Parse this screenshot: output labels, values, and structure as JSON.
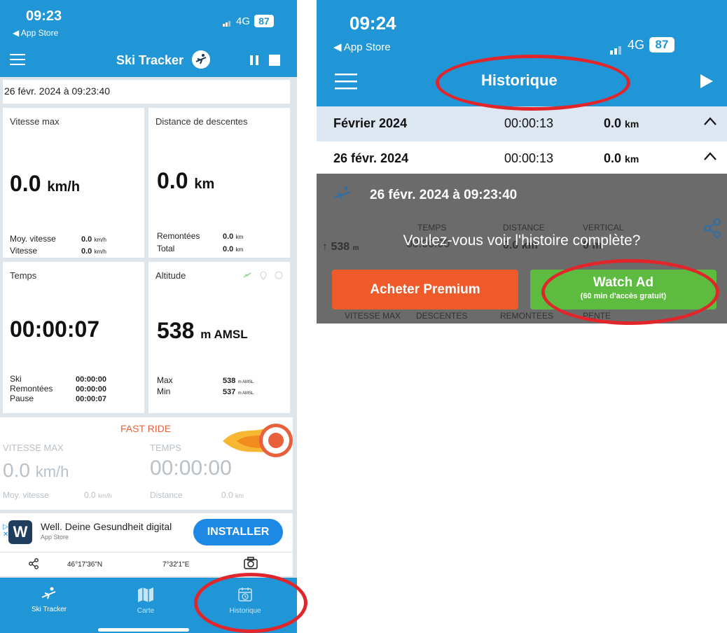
{
  "left": {
    "status": {
      "time": "09:23",
      "back": "◀ App Store",
      "network": "4G",
      "battery": "87"
    },
    "header": {
      "title": "Ski Tracker"
    },
    "date": "26 févr. 2024 à 09:23:40",
    "speed_card": {
      "label": "Vitesse max",
      "value": "0.0",
      "unit": "km/h",
      "avg_label": "Moy. vitesse",
      "avg_value": "0.0",
      "avg_unit": "km/h",
      "speed_label": "Vitesse",
      "speed_value": "0.0",
      "speed_unit": "km/h"
    },
    "distance_card": {
      "label": "Distance de descentes",
      "value": "0.0",
      "unit": "km",
      "lifts_label": "Remontées",
      "lifts_value": "0.0",
      "lifts_unit": "km",
      "total_label": "Total",
      "total_value": "0.0",
      "total_unit": "km"
    },
    "time_card": {
      "label": "Temps",
      "value": "00:00:07",
      "ski_label": "Ski",
      "ski_value": "00:00:00",
      "lifts_label": "Remontées",
      "lifts_value": "00:00:00",
      "pause_label": "Pause",
      "pause_value": "00:00:07"
    },
    "altitude_card": {
      "label": "Altitude",
      "value": "538",
      "unit": "m AMSL",
      "max_label": "Max",
      "max_value": "538",
      "min_label": "Min",
      "min_value": "537",
      "small_unit": "m AMSL"
    },
    "fast_ride": {
      "title": "FAST RIDE",
      "vmax_label": "VITESSE MAX",
      "vmax_value": "0.0",
      "vmax_unit": "km/h",
      "time_label": "TEMPS",
      "time_value": "00:00:00",
      "avg_label": "Moy. vitesse",
      "avg_value": "0.0",
      "avg_unit": "km/h",
      "dist_label": "Distance",
      "dist_value": "0.0",
      "dist_unit": "km"
    },
    "ad": {
      "title": "Well. Deine Gesundheit digital",
      "subtitle": "App Store",
      "button": "INSTALLER"
    },
    "coords": {
      "lat": "46°17'36\"N",
      "lon": "7°32'1\"E"
    },
    "tabs": {
      "ski_tracker": "Ski Tracker",
      "carte": "Carte",
      "historique": "Historique"
    }
  },
  "right": {
    "status": {
      "time": "09:24",
      "back": "◀ App Store",
      "network": "4G",
      "battery": "87"
    },
    "title": "Historique",
    "month_row": {
      "label": "Février 2024",
      "time": "00:00:13",
      "distance": "0.0",
      "unit": "km"
    },
    "day_row": {
      "label": "26 févr. 2024",
      "time": "00:00:13",
      "distance": "0.0",
      "unit": "km"
    },
    "session": {
      "date": "26 févr. 2024 à 09:23:40"
    },
    "headers": {
      "temps": "TEMPS",
      "distance": "DISTANCE",
      "vertical": "VERTICAL"
    },
    "ghost": {
      "alt": "538",
      "alt_unit": "m",
      "time": "00:00:00",
      "dist": "0.0 km",
      "vert": "0 m"
    },
    "question": "Voulez-vous voir l'histoire complète?",
    "buttons": {
      "premium": "Acheter Premium",
      "watch_ad": "Watch Ad",
      "watch_ad_sub": "(60 min d'accès gratuit)"
    },
    "bottom_headers": {
      "vmax": "VITESSE MAX",
      "descentes": "DESCENTES",
      "remontees": "REMONTEES",
      "pente": "PENTE"
    }
  },
  "colors": {
    "brand_blue": "#2196d6",
    "annotation_red": "#e0262b",
    "premium_orange": "#ef5a2b",
    "watch_green": "#5dbb3f",
    "fast_ride_orange": "#e8603c"
  }
}
